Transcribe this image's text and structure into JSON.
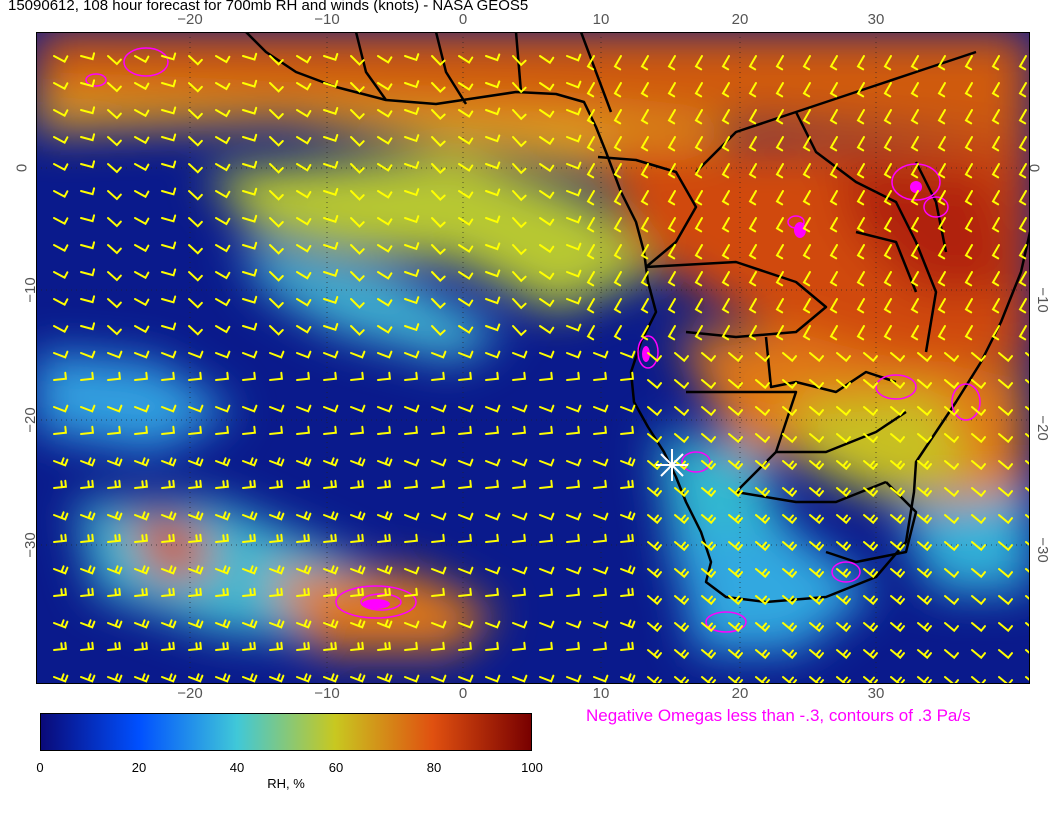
{
  "title": "15090612, 108 hour forecast for 700mb RH and winds (knots) - NASA GEOS5",
  "map": {
    "lon_ticks": [
      "−20",
      "−10",
      "0",
      "10",
      "20",
      "30"
    ],
    "lat_ticks": [
      "0",
      "−10",
      "−20",
      "−30"
    ],
    "field": "Relative humidity",
    "overlays": [
      "wind-barbs",
      "omega-contours",
      "country-borders",
      "coastlines",
      "station-marker"
    ]
  },
  "colorbar": {
    "labels": [
      "0",
      "20",
      "40",
      "60",
      "80",
      "100"
    ],
    "title": "RH, %",
    "stops": [
      "#0a0a78",
      "#0050ff",
      "#40c8d8",
      "#c8c820",
      "#e05010",
      "#780000"
    ]
  },
  "omega_note": "Negative Omegas less than -.3, contours of .3 Pa/s",
  "colors": {
    "barb": "#ffff00",
    "omega": "#ff00ff",
    "border": "#000000"
  },
  "marker": {
    "icon": "star-marker",
    "lon": 15,
    "lat": -23
  }
}
